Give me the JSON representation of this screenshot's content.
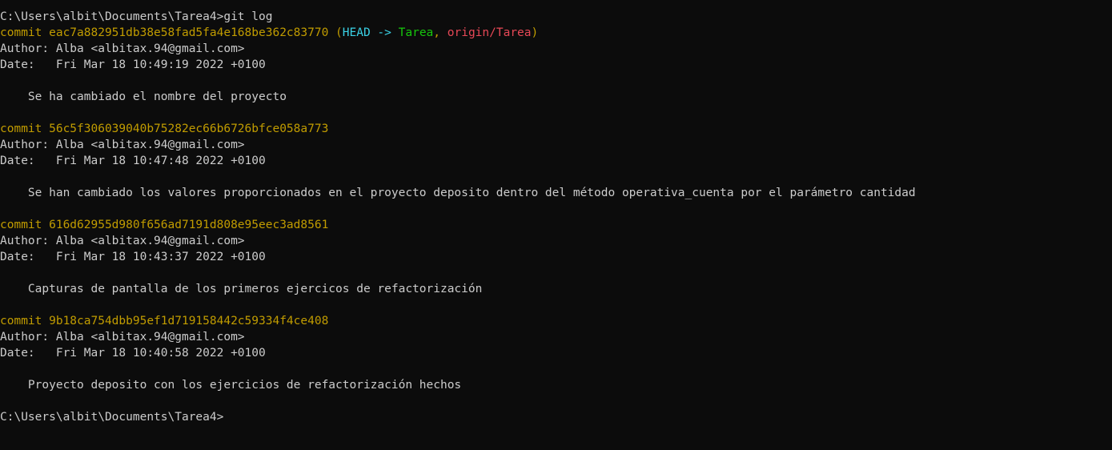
{
  "terminal": {
    "prompt_cmd": "C:\\Users\\albit\\Documents\\Tarea4>git log",
    "final_prompt": "C:\\Users\\albit\\Documents\\Tarea4>",
    "colors": {
      "background": "#0c0c0c",
      "text": "#cccccc",
      "commit": "#c19c00",
      "head": "#3ad2e6",
      "branch": "#16c60c",
      "remote": "#e74856"
    },
    "commits": [
      {
        "commit_line": "commit eac7a882951db38e58fad5fa4e168be362c83770",
        "refs": {
          "open": " (",
          "head": "HEAD -> ",
          "branch": "Tarea",
          "sep": ", ",
          "remote": "origin/Tarea",
          "close": ")"
        },
        "author": "Author: Alba <albitax.94@gmail.com>",
        "date": "Date:   Fri Mar 18 10:49:19 2022 +0100",
        "message": "    Se ha cambiado el nombre del proyecto"
      },
      {
        "commit_line": "commit 56c5f306039040b75282ec66b6726bfce058a773",
        "author": "Author: Alba <albitax.94@gmail.com>",
        "date": "Date:   Fri Mar 18 10:47:48 2022 +0100",
        "message": "    Se han cambiado los valores proporcionados en el proyecto deposito dentro del método operativa_cuenta por el parámetro cantidad"
      },
      {
        "commit_line": "commit 616d62955d980f656ad7191d808e95eec3ad8561",
        "author": "Author: Alba <albitax.94@gmail.com>",
        "date": "Date:   Fri Mar 18 10:43:37 2022 +0100",
        "message": "    Capturas de pantalla de los primeros ejercicos de refactorización"
      },
      {
        "commit_line": "commit 9b18ca754dbb95ef1d719158442c59334f4ce408",
        "author": "Author: Alba <albitax.94@gmail.com>",
        "date": "Date:   Fri Mar 18 10:40:58 2022 +0100",
        "message": "    Proyecto deposito con los ejercicios de refactorización hechos"
      }
    ]
  }
}
